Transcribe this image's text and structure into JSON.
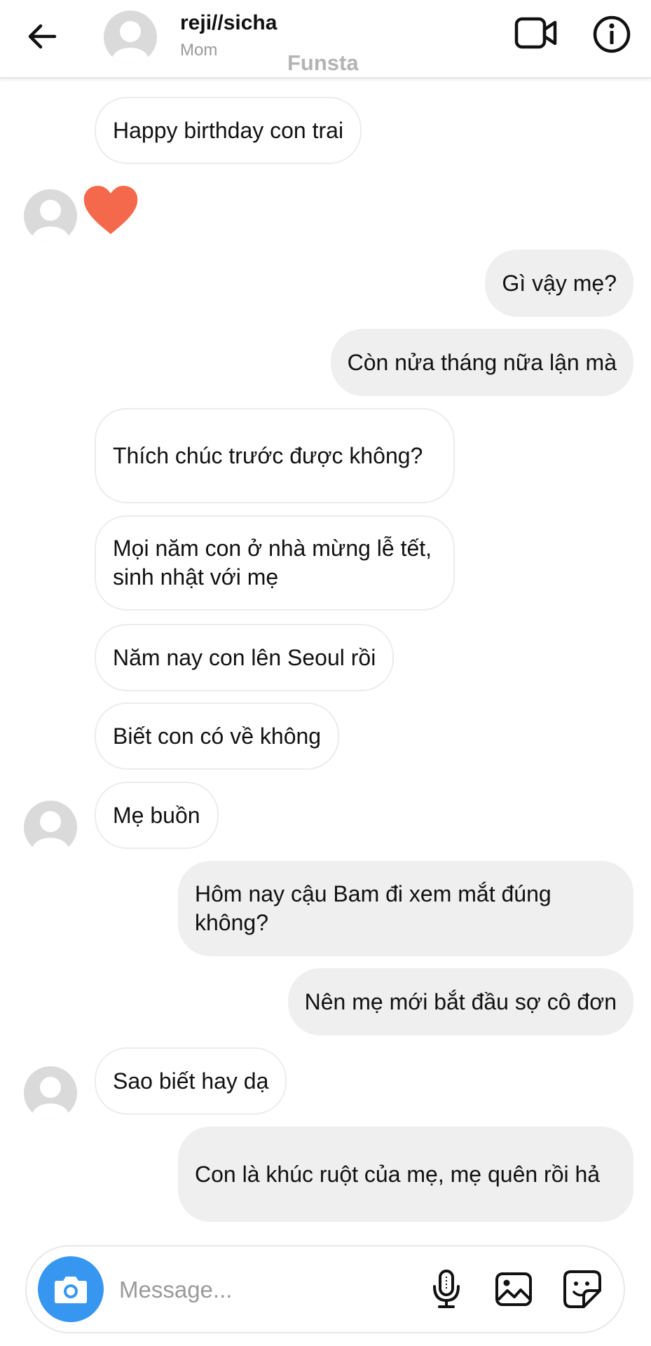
{
  "header": {
    "contact_name": "reji//sicha",
    "contact_subtitle": "Mom",
    "watermark": "Funsta",
    "icons": [
      "back-arrow-icon",
      "video-call-icon",
      "info-icon"
    ]
  },
  "messages": [
    {
      "from": "them",
      "text": "Happy birthday con trai"
    },
    {
      "from": "them",
      "type": "reaction",
      "icon": "heart-icon",
      "color": "#f4694b"
    },
    {
      "from": "me",
      "text": "Gì vậy mẹ?"
    },
    {
      "from": "me",
      "text": "Còn nửa tháng nữa lận mà"
    },
    {
      "from": "them",
      "text": "Thích chúc trước được không?"
    },
    {
      "from": "them",
      "text": "Mọi năm con ở nhà mừng lễ tết, sinh nhật với mẹ"
    },
    {
      "from": "them",
      "text": "Năm nay con lên Seoul rồi"
    },
    {
      "from": "them",
      "text": "Biết con có về không"
    },
    {
      "from": "them",
      "text": "Mẹ buồn"
    },
    {
      "from": "me",
      "text": "Hôm nay cậu Bam đi xem mắt đúng không?"
    },
    {
      "from": "me",
      "text": "Nên mẹ mới bắt đầu sợ cô đơn"
    },
    {
      "from": "them",
      "text": "Sao biết hay dạ"
    },
    {
      "from": "me",
      "text": "Con là khúc ruột của mẹ, mẹ quên rồi hả"
    }
  ],
  "composer": {
    "placeholder": "Message...",
    "icons": [
      "camera-icon",
      "microphone-icon",
      "gallery-icon",
      "sticker-icon"
    ]
  },
  "colors": {
    "accent": "#3797f0",
    "heart": "#f4694b",
    "outgoing_bubble": "#efefef",
    "incoming_border": "#ececec"
  }
}
